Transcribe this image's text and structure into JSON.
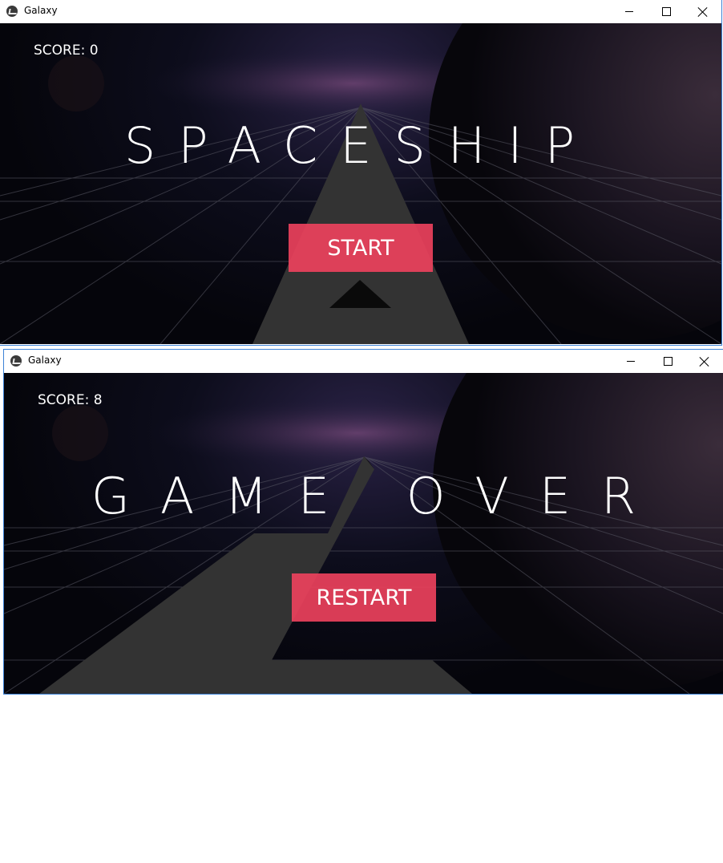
{
  "window_start": {
    "title": "Galaxy",
    "score_text": "SCORE: 0",
    "heading": "SPACESHIP",
    "button_label": "START"
  },
  "window_gameover": {
    "title": "Galaxy",
    "score_text": "SCORE: 8",
    "heading": "GAME OVER",
    "button_label": "RESTART"
  },
  "colors": {
    "button": "#e0455f",
    "track": "#333333",
    "background": "#05050b"
  },
  "icons": [
    "app-icon",
    "minimize-icon",
    "maximize-icon",
    "close-icon",
    "ship-icon"
  ]
}
